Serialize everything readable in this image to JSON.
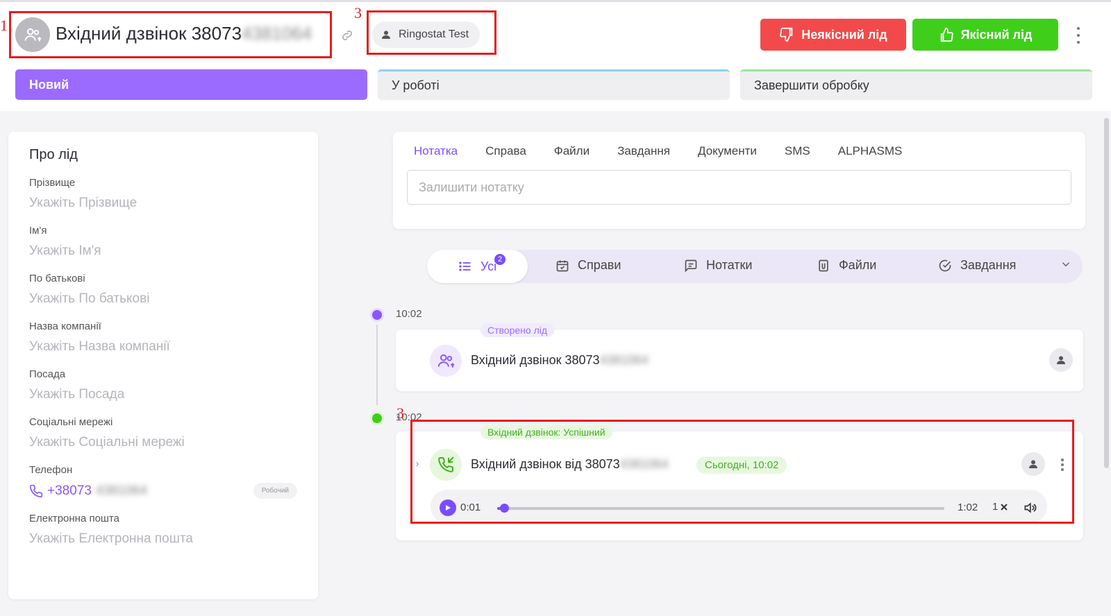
{
  "header": {
    "title_prefix": "Вхідний дзвінок 38073",
    "title_blurred": "4381064",
    "owner": "Ringostat Test",
    "btn_bad": "Неякісний лід",
    "btn_good": "Якісний лід"
  },
  "stages": [
    "Новий",
    "У роботі",
    "Завершити обробку"
  ],
  "annotations": {
    "n1": "1",
    "n2": "3",
    "n3": "3"
  },
  "lead_card": {
    "title": "Про лід",
    "fields": [
      {
        "label": "Прізвище",
        "placeholder": "Укажіть Прізвище"
      },
      {
        "label": "Ім'я",
        "placeholder": "Укажіть Ім'я"
      },
      {
        "label": "По батькові",
        "placeholder": "Укажіть По батькові"
      },
      {
        "label": "Назва компанії",
        "placeholder": "Укажіть Назва компанії"
      },
      {
        "label": "Посада",
        "placeholder": "Укажіть Посада"
      },
      {
        "label": "Соціальні мережі",
        "placeholder": "Укажіть Соціальні мережі"
      }
    ],
    "phone_label": "Телефон",
    "phone_value": "+38073",
    "phone_blurred": "4381064",
    "phone_type": "Робочий",
    "email_label": "Електронна пошта",
    "email_placeholder": "Укажіть Електронна пошта"
  },
  "note_tabs": [
    "Нотатка",
    "Справа",
    "Файли",
    "Завдання",
    "Документи",
    "SMS",
    "ALPHASMS"
  ],
  "note_placeholder": "Залишити нотатку",
  "filters": {
    "all": "Усі",
    "all_count": "2",
    "items": [
      "Справи",
      "Нотатки",
      "Файли",
      "Завдання"
    ]
  },
  "timeline": {
    "time1": "10:02",
    "time2": "10:02",
    "event1_label": "Створено лід",
    "event1_title": "Вхідний дзвінок 38073",
    "event1_blurred": "4381064",
    "event2_label": "Вхідний дзвінок: Успішний",
    "event2_title": "Вхідний дзвінок від 38073",
    "event2_blurred": "4381064",
    "event2_time": "Сьогодні, 10:02",
    "player": {
      "current": "0:01",
      "total": "1:02",
      "speed": "1",
      "progress": 0.016
    }
  },
  "colors": {
    "accent": "#7a4dff",
    "bad": "#f24a4a",
    "good": "#3fcf1b",
    "annotation": "#e81c1c"
  }
}
